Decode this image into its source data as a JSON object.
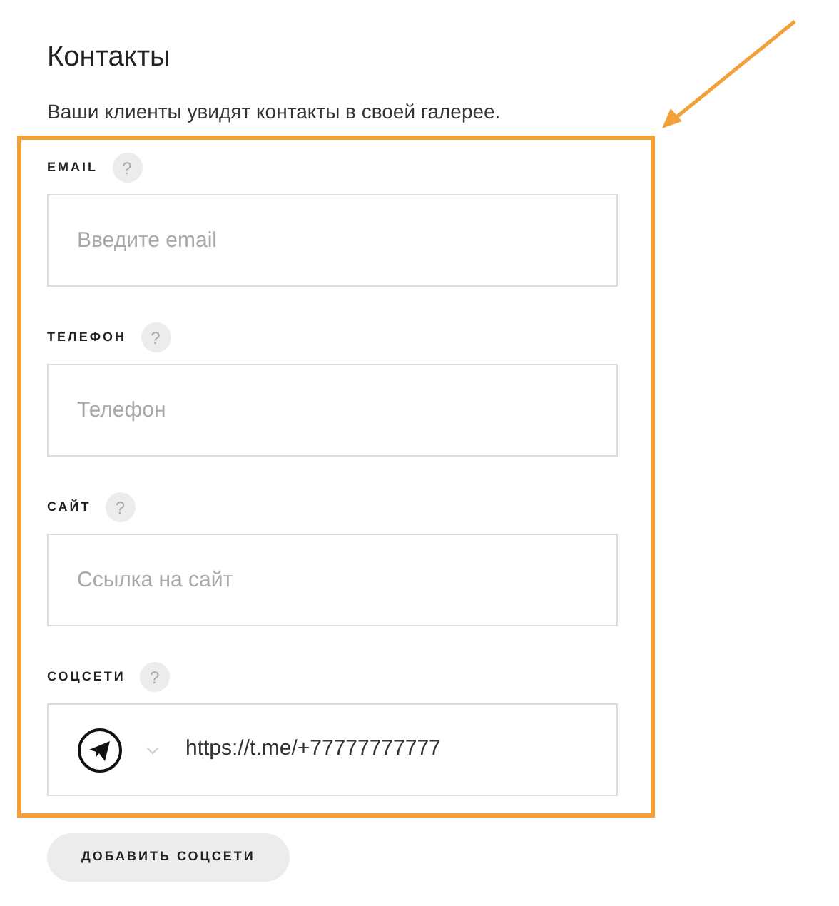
{
  "title": "Контакты",
  "subtitle": "Ваши клиенты увидят контакты в своей галерее.",
  "fields": [
    {
      "kind": "text",
      "label": "EMAIL",
      "help": "?",
      "placeholder": "Введите email"
    },
    {
      "kind": "text",
      "label": "ТЕЛЕФОН",
      "help": "?",
      "placeholder": "Телефон"
    },
    {
      "kind": "text",
      "label": "САЙТ",
      "help": "?",
      "placeholder": "Ссылка на сайт"
    },
    {
      "kind": "social",
      "label": "СОЦСЕТИ",
      "help": "?",
      "value": "https://t.me/+77777777777"
    }
  ],
  "add_button": "ДОБАВИТЬ СОЦСЕТИ"
}
